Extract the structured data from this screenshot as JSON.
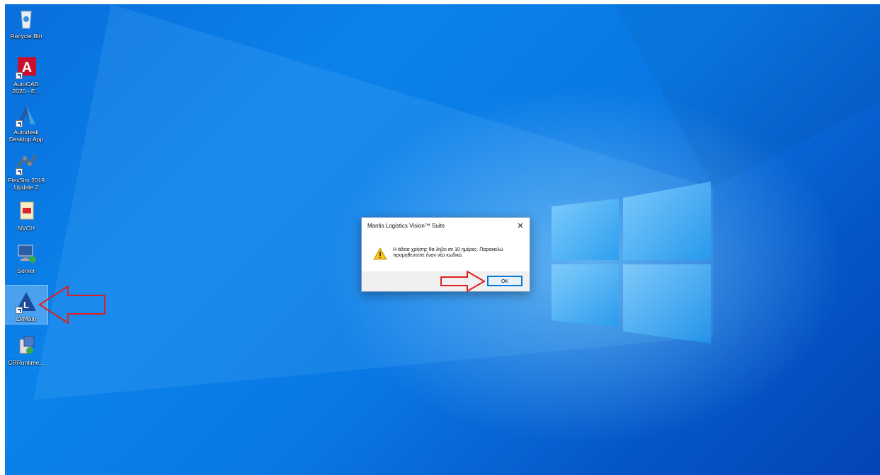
{
  "desktop_icons": [
    {
      "label": "Recycle Bin",
      "icon": "recycle-bin-icon"
    },
    {
      "label": "AutoCAD\n2020 - E...",
      "icon": "autocad-icon"
    },
    {
      "label": "Autodesk\nDesktop App",
      "icon": "autodesk-desktop-app-icon"
    },
    {
      "label": "FlexSim 2019\nUpdate 2",
      "icon": "flexsim-icon"
    },
    {
      "label": "NVCH",
      "icon": "pdf-file-icon"
    },
    {
      "label": "Server",
      "icon": "server-computer-icon"
    },
    {
      "label": "LVMain",
      "icon": "lvmain-icon"
    },
    {
      "label": "CRRuntime...",
      "icon": "installer-package-icon"
    }
  ],
  "dialog": {
    "title": "Mantis Logistics Vision™ Suite",
    "close_glyph": "✕",
    "message": "Η άδεια χρήσης θα λήξει σε 10 ημέρες. Παρακαλώ προμηθευτείτε έναν νέο κωδικό.",
    "ok_label": "OK"
  },
  "colors": {
    "annotation_arrow": "#e02020",
    "accent_button_border": "#0078d7",
    "selected_icon": "#bfe1ff"
  }
}
